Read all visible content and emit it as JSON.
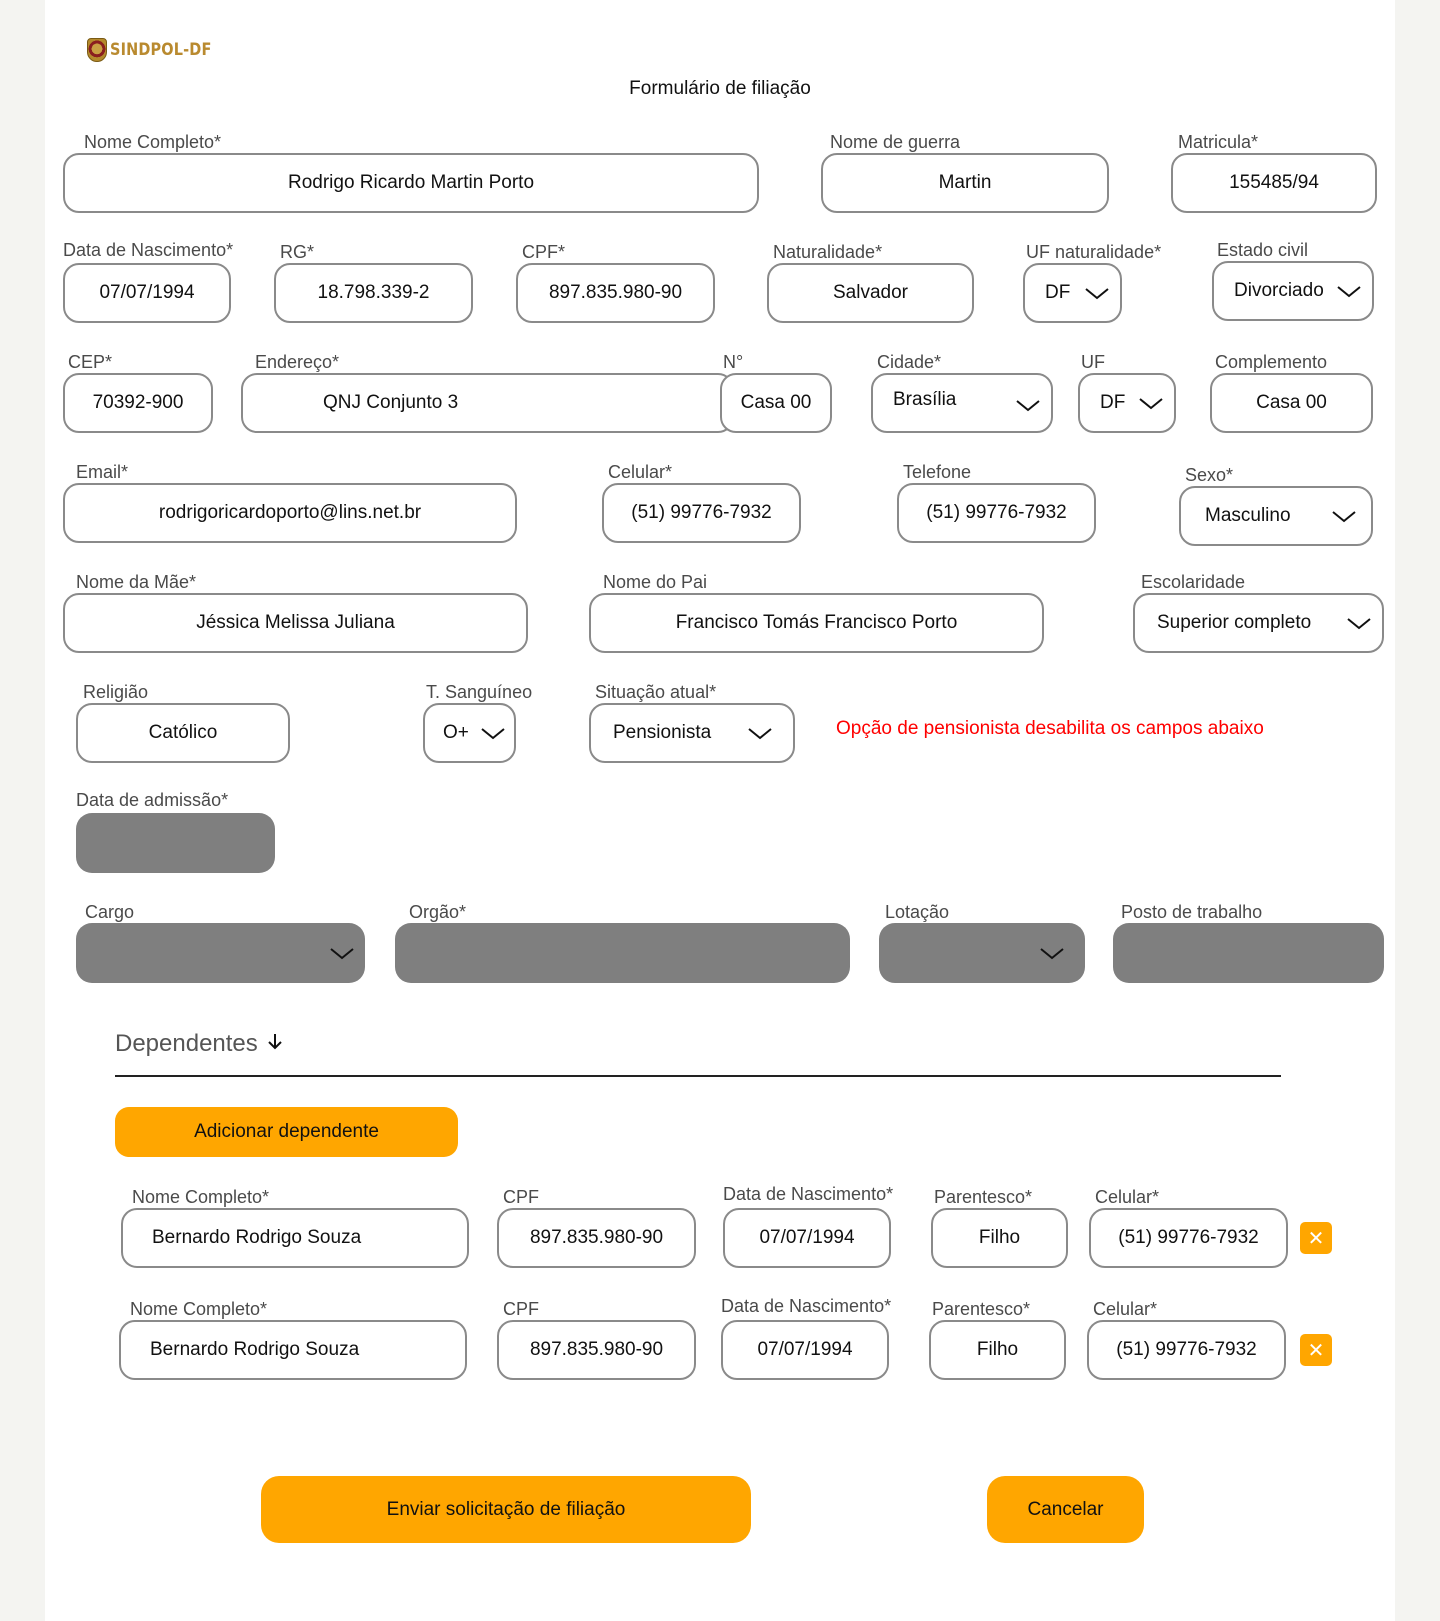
{
  "brand": {
    "name": "SINDPOL-DF",
    "logo_icon": "police-badge-icon"
  },
  "form": {
    "title": "Formulário de filiação",
    "nome_completo": {
      "label": "Nome Completo*",
      "value": "Rodrigo Ricardo Martin Porto"
    },
    "nome_guerra": {
      "label": "Nome de guerra",
      "value": "Martin"
    },
    "matricula": {
      "label": "Matricula*",
      "value": "155485/94"
    },
    "data_nascimento": {
      "label": "Data de Nascimento*",
      "value": "07/07/1994"
    },
    "rg": {
      "label": "RG*",
      "value": "18.798.339-2"
    },
    "cpf": {
      "label": "CPF*",
      "value": "897.835.980-90"
    },
    "naturalidade": {
      "label": "Naturalidade*",
      "value": "Salvador"
    },
    "uf_naturalidade": {
      "label": "UF naturalidade*",
      "value": "DF"
    },
    "estado_civil": {
      "label": "Estado civil",
      "value": "Divorciado"
    },
    "cep": {
      "label": "CEP*",
      "value": "70392-900"
    },
    "endereco": {
      "label": "Endereço*",
      "value": "QNJ Conjunto 3"
    },
    "numero": {
      "label": "N°",
      "value": "Casa 00"
    },
    "cidade": {
      "label": "Cidade*",
      "value": "Brasília"
    },
    "uf": {
      "label": "UF",
      "value": "DF"
    },
    "complemento": {
      "label": "Complemento",
      "value": "Casa 00"
    },
    "email": {
      "label": "Email*",
      "value": "rodrigoricardoporto@lins.net.br"
    },
    "celular": {
      "label": "Celular*",
      "value": "(51) 99776-7932"
    },
    "telefone": {
      "label": "Telefone",
      "value": "(51) 99776-7932"
    },
    "sexo": {
      "label": "Sexo*",
      "value": "Masculino"
    },
    "nome_mae": {
      "label": "Nome da Mãe*",
      "value": "Jéssica Melissa Juliana"
    },
    "nome_pai": {
      "label": "Nome do Pai",
      "value": "Francisco Tomás Francisco Porto"
    },
    "escolaridade": {
      "label": "Escolaridade",
      "value": "Superior completo"
    },
    "religiao": {
      "label": "Religião",
      "value": "Católico"
    },
    "tipo_sanguineo": {
      "label": "T. Sanguíneo",
      "value": "O+"
    },
    "situacao_atual": {
      "label": "Situação atual*",
      "value": "Pensionista"
    },
    "warning": "Opção de pensionista desabilita os campos abaixo",
    "data_admissao": {
      "label": "Data de admissão*",
      "value": ""
    },
    "cargo": {
      "label": "Cargo",
      "value": ""
    },
    "orgao": {
      "label": "Orgão*",
      "value": ""
    },
    "lotacao": {
      "label": "Lotação",
      "value": ""
    },
    "posto_trabalho": {
      "label": "Posto de trabalho",
      "value": ""
    }
  },
  "dependentes": {
    "heading": "Dependentes",
    "heading_icon": "arrow-down-icon",
    "add_button": "Adicionar dependente",
    "labels": {
      "nome": "Nome Completo*",
      "cpf": "CPF",
      "nascimento": "Data de Nascimento*",
      "parentesco": "Parentesco*",
      "celular": "Celular*"
    },
    "rows": [
      {
        "nome": "Bernardo Rodrigo Souza",
        "cpf": "897.835.980-90",
        "nascimento": "07/07/1994",
        "parentesco": "Filho",
        "celular": "(51) 99776-7932",
        "remove_icon": "✕"
      },
      {
        "nome": "Bernardo Rodrigo Souza",
        "cpf": "897.835.980-90",
        "nascimento": "07/07/1994",
        "parentesco": "Filho",
        "celular": "(51) 99776-7932",
        "remove_icon": "✕"
      }
    ]
  },
  "actions": {
    "submit": "Enviar solicitação de filiação",
    "cancel": "Cancelar"
  },
  "colors": {
    "accent": "#ffa600",
    "warning": "#ff0000",
    "disabled": "#7f7f7f",
    "border": "#8a8a8a"
  }
}
